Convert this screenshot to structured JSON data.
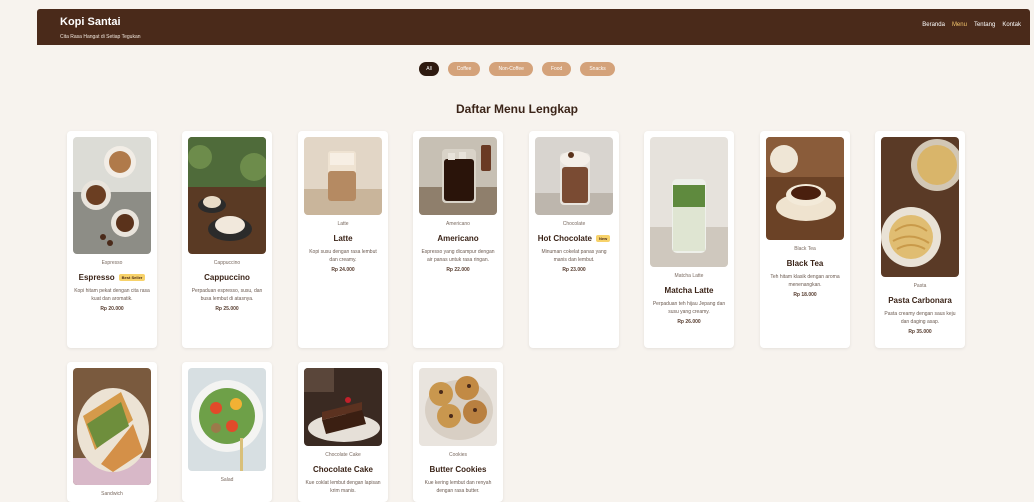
{
  "header": {
    "brand_title": "Kopi Santai",
    "brand_tagline": "Cita Rasa Hangat di Setiap Tegukan",
    "nav": [
      "Beranda",
      "Menu",
      "Tentang",
      "Kontak"
    ],
    "active_nav": "Menu"
  },
  "filters": [
    "All",
    "Coffee",
    "Non-Coffee",
    "Food",
    "Snacks"
  ],
  "active_filter": "All",
  "section_title": "Daftar Menu Lengkap",
  "items": [
    {
      "category": "Espresso",
      "name": "Espresso",
      "badge": "Best Seller",
      "desc": "Kopi hitam pekat dengan cita rasa kuat dan aromatik.",
      "price": "Rp 20.000"
    },
    {
      "category": "Cappuccino",
      "name": "Cappuccino",
      "badge": "",
      "desc": "Perpaduan espresso, susu, dan busa lembut di atasnya.",
      "price": "Rp 25.000"
    },
    {
      "category": "Latte",
      "name": "Latte",
      "badge": "",
      "desc": "Kopi susu dengan rasa lembut dan creamy.",
      "price": "Rp 24.000"
    },
    {
      "category": "Americano",
      "name": "Americano",
      "badge": "",
      "desc": "Espresso yang dicampur dengan air panas untuk rasa ringan.",
      "price": "Rp 22.000"
    },
    {
      "category": "Chocolate",
      "name": "Hot Chocolate",
      "badge": "New",
      "desc": "Minuman cokelat panas yang manis dan lembut.",
      "price": "Rp 23.000"
    },
    {
      "category": "Matcha Latte",
      "name": "Matcha Latte",
      "badge": "",
      "desc": "Perpaduan teh hijau Jepang dan susu yang creamy.",
      "price": "Rp 26.000"
    },
    {
      "category": "Black Tea",
      "name": "Black Tea",
      "badge": "",
      "desc": "Teh hitam klasik dengan aroma menenangkan.",
      "price": "Rp 18.000"
    },
    {
      "category": "Pasta",
      "name": "Pasta Carbonara",
      "badge": "",
      "desc": "Pasta creamy dengan saus keju dan daging asap.",
      "price": "Rp 35.000"
    },
    {
      "category": "Sandwich",
      "name": "",
      "badge": "",
      "desc": "",
      "price": ""
    },
    {
      "category": "Salad",
      "name": "",
      "badge": "",
      "desc": "",
      "price": ""
    },
    {
      "category": "Chocolate Cake",
      "name": "Chocolate Cake",
      "badge": "",
      "desc": "Kue coklat lembut dengan lapisan krim manis.",
      "price": ""
    },
    {
      "category": "Cookies",
      "name": "Butter Cookies",
      "badge": "",
      "desc": "Kue kering lembut dan renyah dengan rasa butter.",
      "price": ""
    }
  ],
  "colors": {
    "header_bg": "#4a2a1a",
    "accent": "#d4a27a",
    "nav_active": "#f5c66d",
    "badge_bg": "#f7d26a"
  }
}
